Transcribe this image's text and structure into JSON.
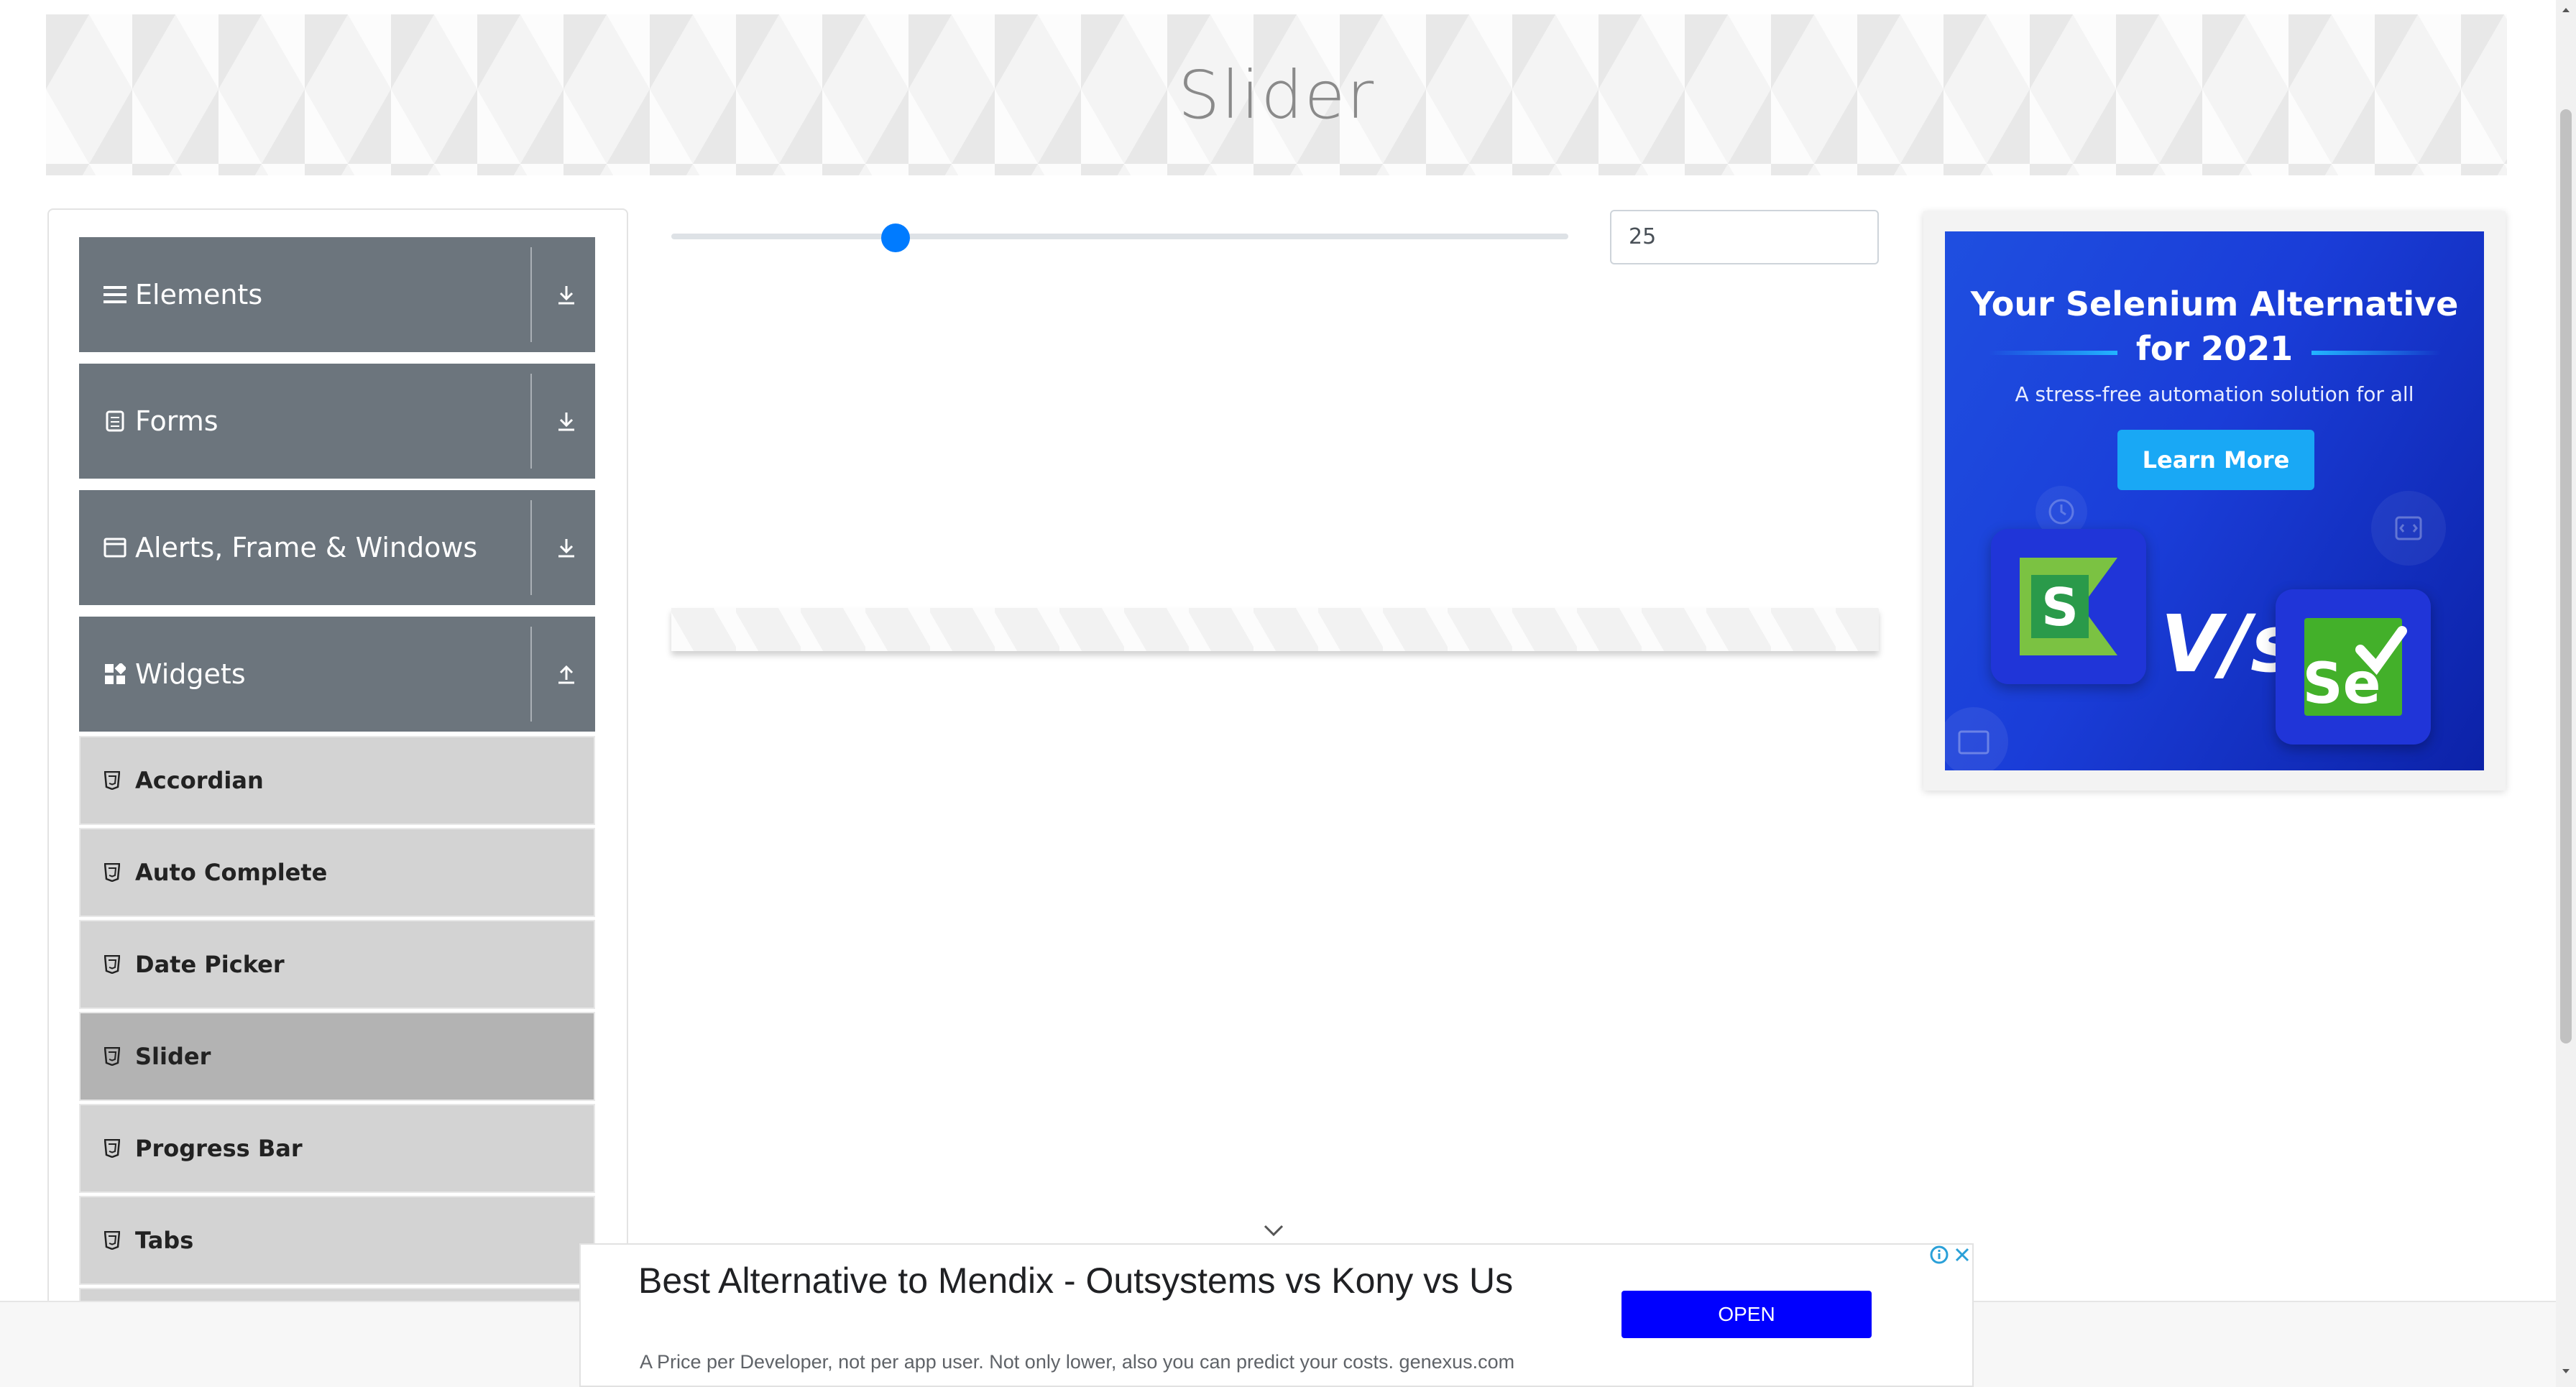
{
  "page": {
    "title": "Slider"
  },
  "sidebar": {
    "groups": [
      {
        "label": "Elements",
        "icon": "hamburger-icon",
        "expanded": false
      },
      {
        "label": "Forms",
        "icon": "document-icon",
        "expanded": false
      },
      {
        "label": "Alerts, Frame & Windows",
        "icon": "window-icon",
        "expanded": false
      },
      {
        "label": "Widgets",
        "icon": "widgets-icon",
        "expanded": true
      }
    ],
    "widget_items": [
      {
        "label": "Accordian",
        "active": false
      },
      {
        "label": "Auto Complete",
        "active": false
      },
      {
        "label": "Date Picker",
        "active": false
      },
      {
        "label": "Slider",
        "active": true
      },
      {
        "label": "Progress Bar",
        "active": false
      },
      {
        "label": "Tabs",
        "active": false
      }
    ]
  },
  "slider": {
    "min": 0,
    "max": 100,
    "value": 25,
    "value_text": "25",
    "thumb_color": "#007bff"
  },
  "ad_right": {
    "title_line1": "Your Selenium Alternative",
    "title_line2": "for 2021",
    "subtitle": "A stress-free automation solution for all",
    "button": "Learn More",
    "vs_text": "V/s",
    "logo_left_letter": "S",
    "logo_right_text": "Se"
  },
  "ad_bottom": {
    "headline": "Best Alternative to Mendix - Outsystems vs Kony vs Us",
    "description": "A Price per Developer, not per app user. Not only lower, also you can predict your costs. genexus.com",
    "button": "OPEN",
    "button_color": "#0000ff"
  },
  "colors": {
    "sidebar_header": "#6c757d",
    "menu_item": "#d3d3d3",
    "menu_item_active": "#b3b3b3",
    "ad_blue": "#1a3dd8",
    "ad_button": "#19a8f5"
  }
}
